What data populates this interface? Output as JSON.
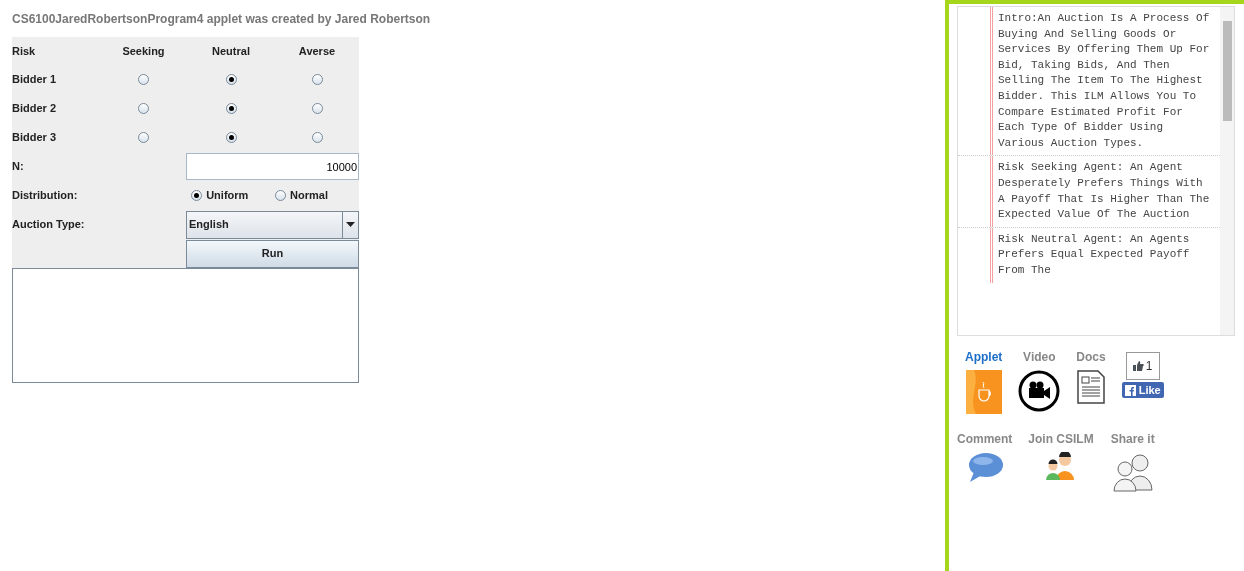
{
  "header": {
    "title": "CS6100JaredRobertsonProgram4 applet was created by Jared Robertson"
  },
  "applet": {
    "risk_header": {
      "label": "Risk",
      "columns": [
        "Seeking",
        "Neutral",
        "Averse"
      ]
    },
    "bidders": [
      {
        "label": "Bidder 1",
        "options": [
          {
            "selected": false
          },
          {
            "selected": true
          },
          {
            "selected": false
          }
        ]
      },
      {
        "label": "Bidder 2",
        "options": [
          {
            "selected": false
          },
          {
            "selected": true
          },
          {
            "selected": false
          }
        ]
      },
      {
        "label": "Bidder 3",
        "options": [
          {
            "selected": false
          },
          {
            "selected": true
          },
          {
            "selected": false
          }
        ]
      }
    ],
    "n": {
      "label": "N:",
      "value": "10000"
    },
    "distribution": {
      "label": "Distribution:",
      "options": [
        {
          "label": "Uniform",
          "selected": true
        },
        {
          "label": "Normal",
          "selected": false
        }
      ]
    },
    "auction_type": {
      "label": "Auction Type:",
      "value": "English"
    },
    "run_button": "Run"
  },
  "sidebar": {
    "docs": [
      "Intro:An Auction Is A Process Of Buying And Selling Goods Or Services By Offering Them Up For Bid, Taking Bids, And Then Selling The Item To The Highest Bidder. This ILM Allows You To Compare Estimated Profit For Each Type Of Bidder Using Various Auction Types.",
      "Risk Seeking Agent: An Agent Desperately Prefers Things With A Payoff That Is Higher Than The Expected Value Of The Auction",
      "Risk Neutral Agent: An Agents Prefers Equal Expected Payoff From The"
    ],
    "links": [
      {
        "kind": "applet",
        "label": "Applet",
        "selected": true
      },
      {
        "kind": "video",
        "label": "Video",
        "selected": false
      },
      {
        "kind": "docs",
        "label": "Docs",
        "selected": false
      },
      {
        "kind": "like",
        "count": "1",
        "label": "Like"
      },
      {
        "kind": "comment",
        "label": "Comment",
        "selected": false
      },
      {
        "kind": "join",
        "label": "Join CSILM",
        "selected": false
      },
      {
        "kind": "share",
        "label": "Share it",
        "selected": false
      }
    ]
  }
}
